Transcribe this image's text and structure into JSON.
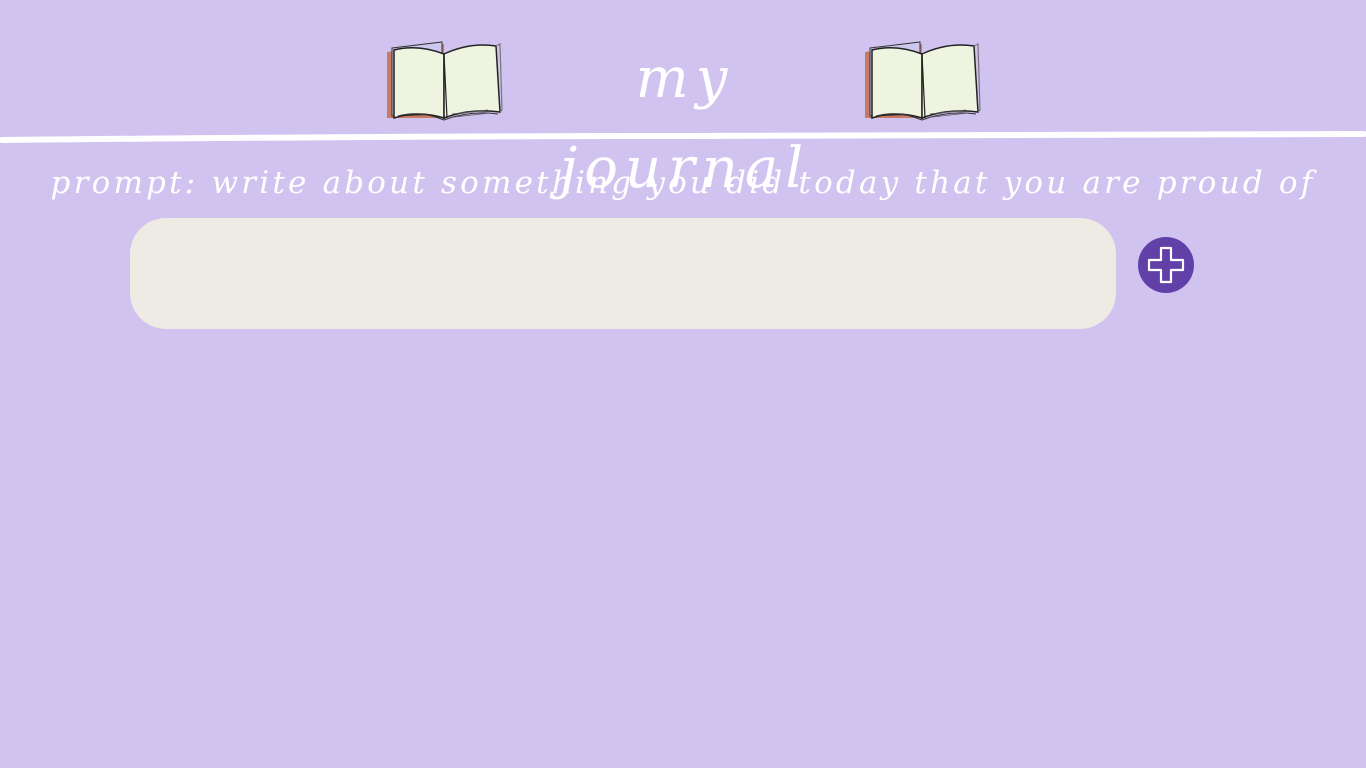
{
  "header": {
    "title": "my journal",
    "left_icon": "open-book-icon",
    "right_icon": "open-book-icon"
  },
  "prompt": {
    "text": "prompt: write about something you did today that you are proud of"
  },
  "entry": {
    "value": "",
    "placeholder": ""
  },
  "add_button": {
    "icon": "plus-icon",
    "label": "add"
  },
  "colors": {
    "background": "#d0c3f0",
    "text": "#ffffff",
    "input_background": "#eeeae4",
    "button": "#6140a8"
  }
}
